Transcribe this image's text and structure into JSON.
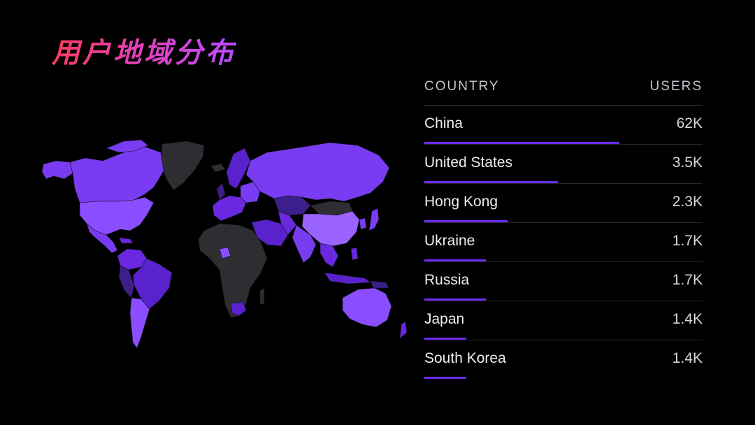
{
  "title": "用户地域分布",
  "title_gradient": [
    "#ff3a5c",
    "#e640b8",
    "#b84cff"
  ],
  "colors": {
    "background": "#000000",
    "bar": "#6a2bf0",
    "map_high": "#8a4dff",
    "map_mid": "#6a28e0",
    "map_low": "#3c1f8a",
    "map_none": "#2e2e32"
  },
  "table": {
    "header_country": "COUNTRY",
    "header_users": "USERS",
    "rows": [
      {
        "country": "China",
        "users": "62K",
        "bar_fraction": 0.7
      },
      {
        "country": "United States",
        "users": "3.5K",
        "bar_fraction": 0.48
      },
      {
        "country": "Hong Kong",
        "users": "2.3K",
        "bar_fraction": 0.3
      },
      {
        "country": "Ukraine",
        "users": "1.7K",
        "bar_fraction": 0.22
      },
      {
        "country": "Russia",
        "users": "1.7K",
        "bar_fraction": 0.22
      },
      {
        "country": "Japan",
        "users": "1.4K",
        "bar_fraction": 0.15
      },
      {
        "country": "South Korea",
        "users": "1.4K",
        "bar_fraction": 0.15
      }
    ]
  }
}
